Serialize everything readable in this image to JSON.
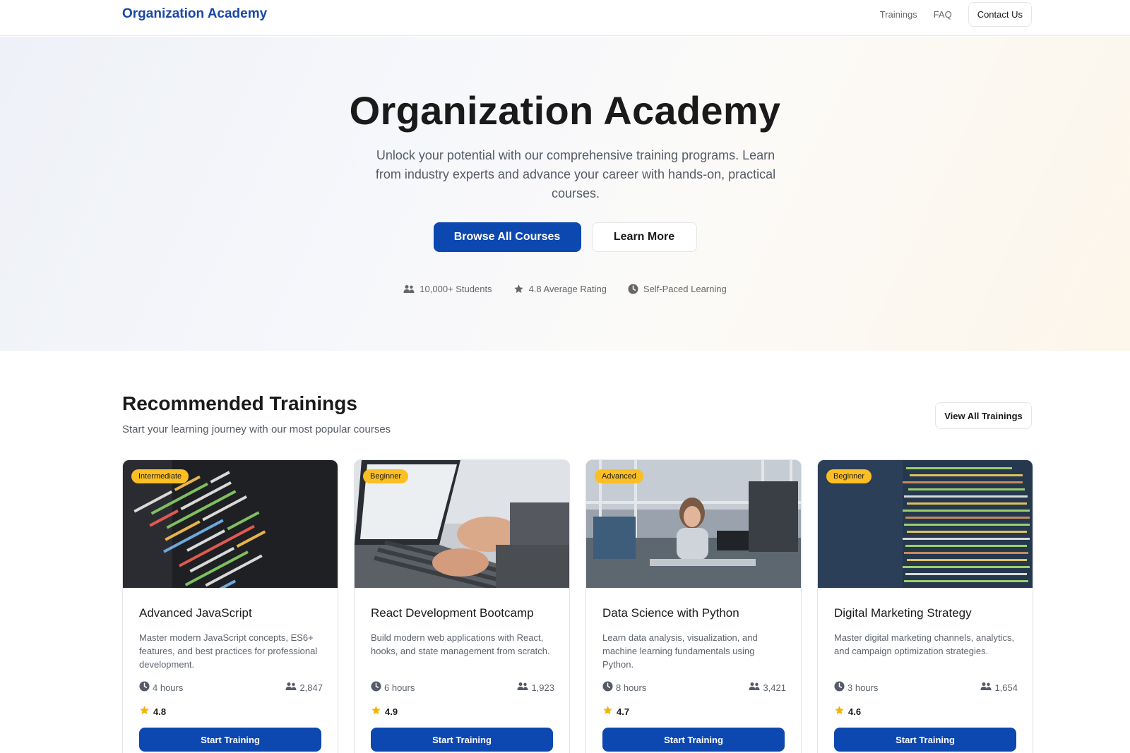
{
  "header": {
    "brand": "Organization Academy",
    "nav": {
      "trainings": "Trainings",
      "faq": "FAQ",
      "contact": "Contact Us"
    }
  },
  "hero": {
    "title": "Organization Academy",
    "subtitle": "Unlock your potential with our comprehensive training programs. Learn from industry experts and advance your career with hands-on, practical courses.",
    "primary_button": "Browse All Courses",
    "secondary_button": "Learn More",
    "stats": {
      "students": "10,000+ Students",
      "rating": "4.8 Average Rating",
      "pace": "Self-Paced Learning"
    }
  },
  "section": {
    "title": "Recommended Trainings",
    "subtitle": "Start your learning journey with our most popular courses",
    "view_all": "View All Trainings"
  },
  "cards": [
    {
      "badge": "Intermediate",
      "title": "Advanced JavaScript",
      "description": "Master modern JavaScript concepts, ES6+ features, and best practices for professional development.",
      "duration": "4 hours",
      "students": "2,847",
      "rating": "4.8",
      "button": "Start Training"
    },
    {
      "badge": "Beginner",
      "title": "React Development Bootcamp",
      "description": "Build modern web applications with React, hooks, and state management from scratch.",
      "duration": "6 hours",
      "students": "1,923",
      "rating": "4.9",
      "button": "Start Training"
    },
    {
      "badge": "Advanced",
      "title": "Data Science with Python",
      "description": "Learn data analysis, visualization, and machine learning fundamentals using Python.",
      "duration": "8 hours",
      "students": "3,421",
      "rating": "4.7",
      "button": "Start Training"
    },
    {
      "badge": "Beginner",
      "title": "Digital Marketing Strategy",
      "description": "Master digital marketing channels, analytics, and campaign optimization strategies.",
      "duration": "3 hours",
      "students": "1,654",
      "rating": "4.6",
      "button": "Start Training"
    }
  ],
  "colors": {
    "brand": "#1a47a6",
    "primary_button": "#0d47b0",
    "badge": "#fbbf24",
    "star": "#f5b301"
  },
  "icons": {
    "students": "users-icon",
    "rating": "star-icon",
    "pace": "clock-icon"
  }
}
